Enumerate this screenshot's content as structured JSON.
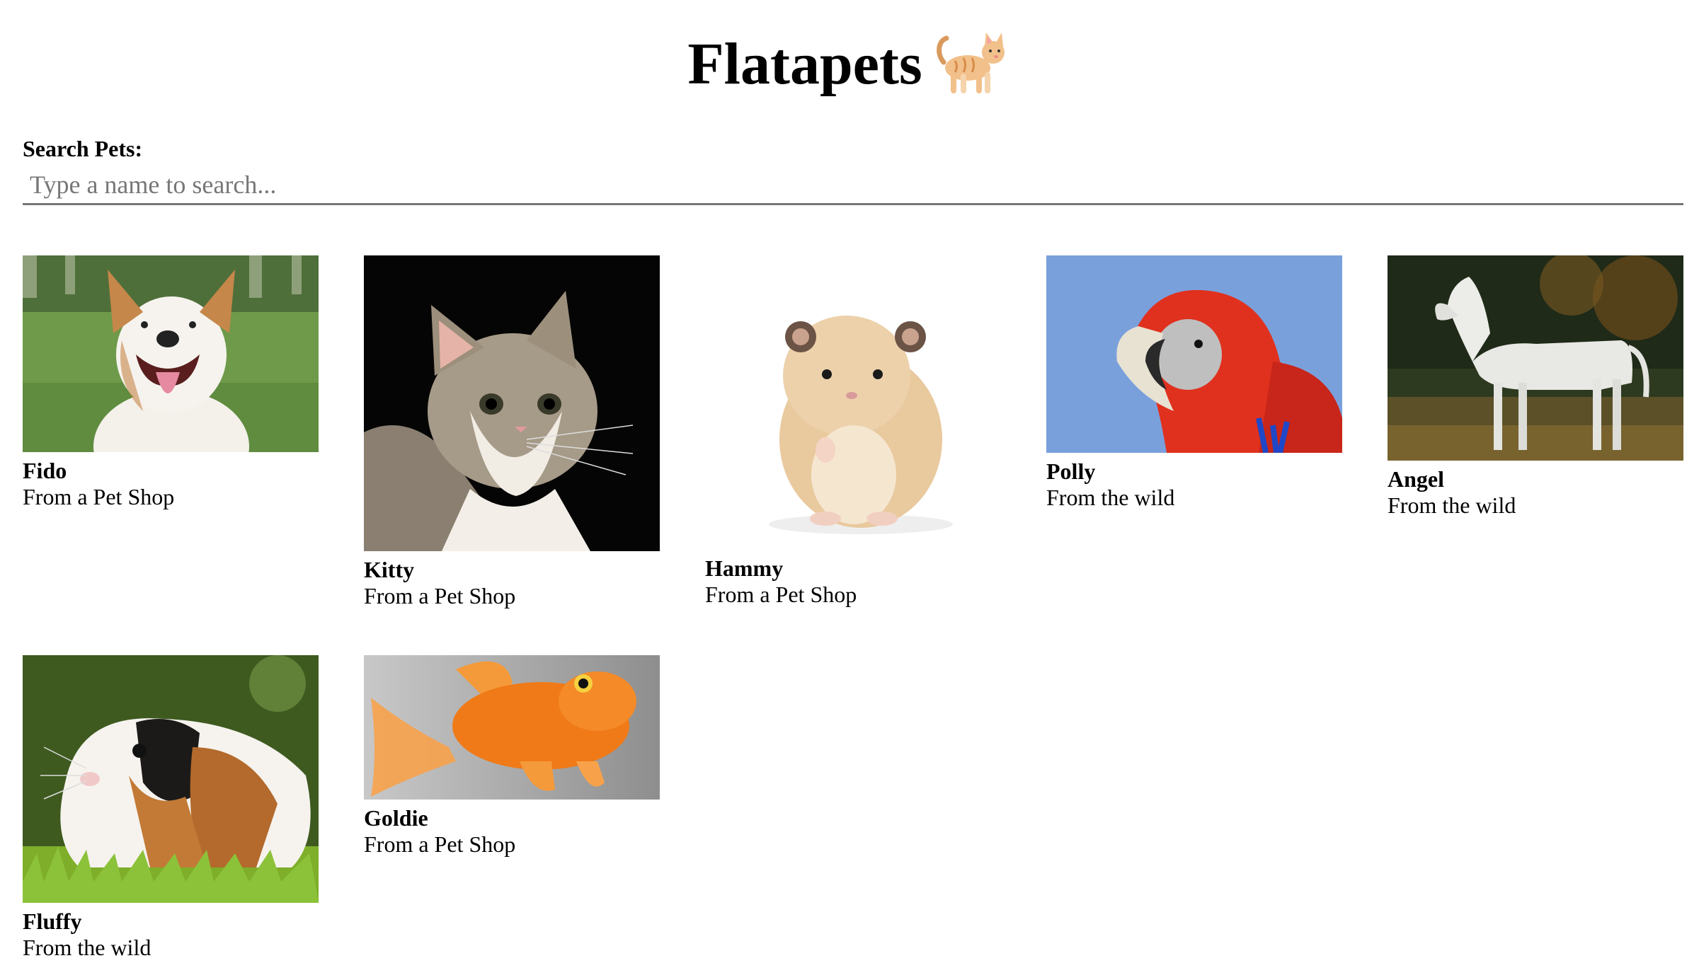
{
  "header": {
    "title": "Flatapets",
    "icon": "cat-icon"
  },
  "search": {
    "label": "Search Pets:",
    "placeholder": "Type a name to search...",
    "value": ""
  },
  "pets": [
    {
      "name": "Fido",
      "origin": "From a Pet Shop",
      "photo": "dog-photo"
    },
    {
      "name": "Kitty",
      "origin": "From a Pet Shop",
      "photo": "cat-photo"
    },
    {
      "name": "Hammy",
      "origin": "From a Pet Shop",
      "photo": "hamster-photo"
    },
    {
      "name": "Polly",
      "origin": "From the wild",
      "photo": "parrot-photo"
    },
    {
      "name": "Angel",
      "origin": "From the wild",
      "photo": "horse-photo"
    },
    {
      "name": "Fluffy",
      "origin": "From the wild",
      "photo": "guinea-pig-photo"
    },
    {
      "name": "Goldie",
      "origin": "From a Pet Shop",
      "photo": "goldfish-photo"
    }
  ]
}
